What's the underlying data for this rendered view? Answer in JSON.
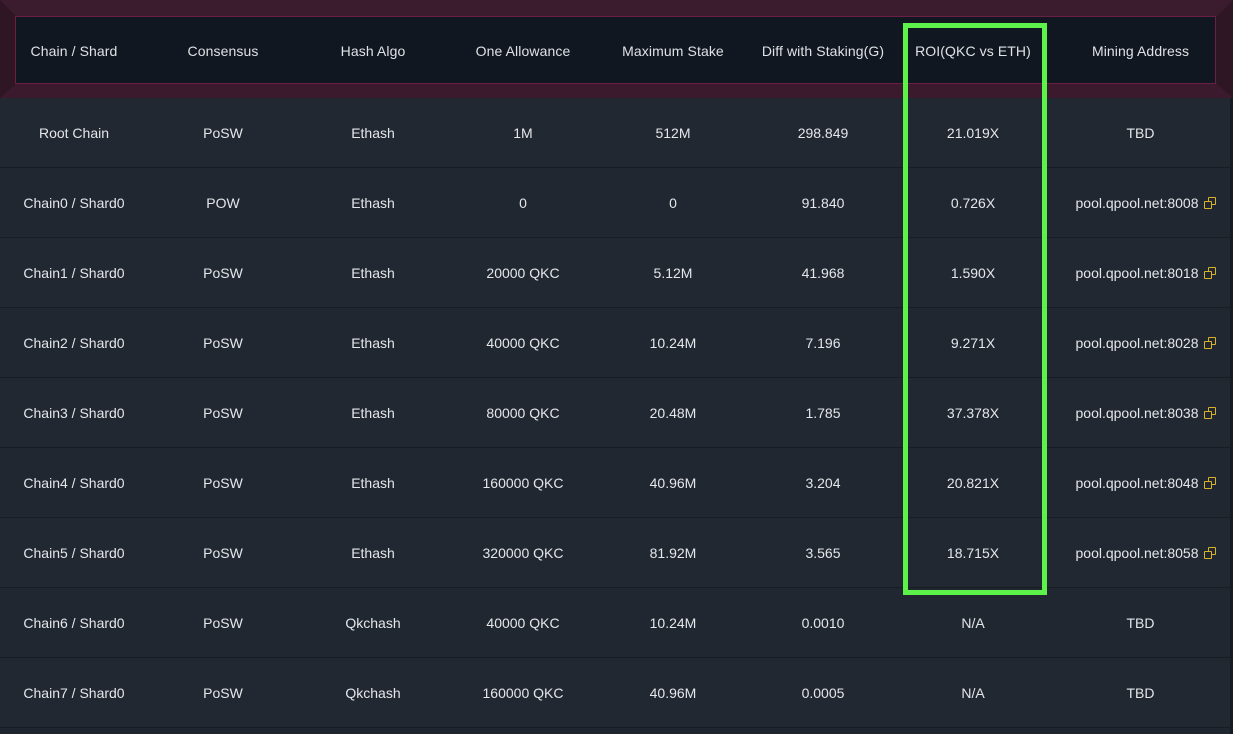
{
  "table": {
    "headers": [
      "Chain / Shard",
      "Consensus",
      "Hash Algo",
      "One Allowance",
      "Maximum Stake",
      "Diff with Staking(G)",
      "ROI(QKC vs ETH)",
      "Mining Address"
    ],
    "rows": [
      {
        "chain": "Root Chain",
        "consensus": "PoSW",
        "hash": "Ethash",
        "allowance": "1M",
        "max_stake": "512M",
        "diff": "298.849",
        "roi": "21.019X",
        "address": "TBD",
        "copyable": false
      },
      {
        "chain": "Chain0 / Shard0",
        "consensus": "POW",
        "hash": "Ethash",
        "allowance": "0",
        "max_stake": "0",
        "diff": "91.840",
        "roi": "0.726X",
        "address": "pool.qpool.net:8008",
        "copyable": true
      },
      {
        "chain": "Chain1 / Shard0",
        "consensus": "PoSW",
        "hash": "Ethash",
        "allowance": "20000 QKC",
        "max_stake": "5.12M",
        "diff": "41.968",
        "roi": "1.590X",
        "address": "pool.qpool.net:8018",
        "copyable": true
      },
      {
        "chain": "Chain2 / Shard0",
        "consensus": "PoSW",
        "hash": "Ethash",
        "allowance": "40000 QKC",
        "max_stake": "10.24M",
        "diff": "7.196",
        "roi": "9.271X",
        "address": "pool.qpool.net:8028",
        "copyable": true
      },
      {
        "chain": "Chain3 / Shard0",
        "consensus": "PoSW",
        "hash": "Ethash",
        "allowance": "80000 QKC",
        "max_stake": "20.48M",
        "diff": "1.785",
        "roi": "37.378X",
        "address": "pool.qpool.net:8038",
        "copyable": true
      },
      {
        "chain": "Chain4 / Shard0",
        "consensus": "PoSW",
        "hash": "Ethash",
        "allowance": "160000 QKC",
        "max_stake": "40.96M",
        "diff": "3.204",
        "roi": "20.821X",
        "address": "pool.qpool.net:8048",
        "copyable": true
      },
      {
        "chain": "Chain5 / Shard0",
        "consensus": "PoSW",
        "hash": "Ethash",
        "allowance": "320000 QKC",
        "max_stake": "81.92M",
        "diff": "3.565",
        "roi": "18.715X",
        "address": "pool.qpool.net:8058",
        "copyable": true
      },
      {
        "chain": "Chain6 / Shard0",
        "consensus": "PoSW",
        "hash": "Qkchash",
        "allowance": "40000 QKC",
        "max_stake": "10.24M",
        "diff": "0.0010",
        "roi": "N/A",
        "address": "TBD",
        "copyable": false
      },
      {
        "chain": "Chain7 / Shard0",
        "consensus": "PoSW",
        "hash": "Qkchash",
        "allowance": "160000 QKC",
        "max_stake": "40.96M",
        "diff": "0.0005",
        "roi": "N/A",
        "address": "TBD",
        "copyable": false
      }
    ]
  },
  "highlight": {
    "color": "#5cf24a",
    "column": "ROI(QKC vs ETH)"
  },
  "colors": {
    "background": "#202630",
    "header_background": "#111720",
    "header_border": "#6b1f45",
    "copy_icon": "#d9b328"
  },
  "icons": {
    "copy": "copy-icon"
  }
}
